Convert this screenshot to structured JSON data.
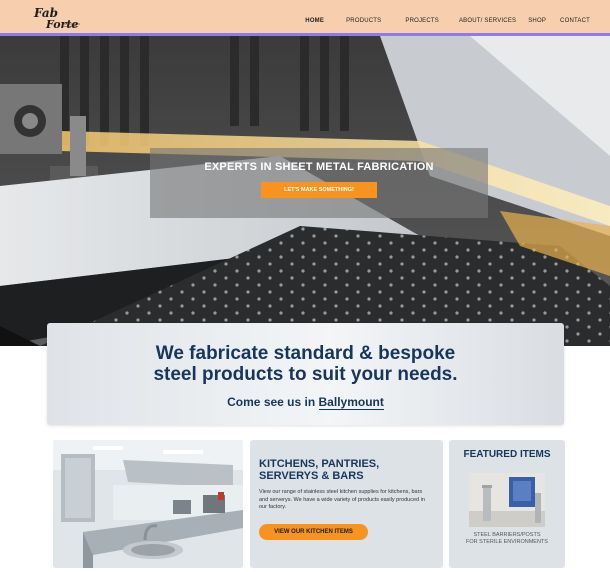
{
  "header": {
    "logo_text": "Fab Forte",
    "nav": [
      {
        "label": "HOME",
        "active": true
      },
      {
        "label": "PRODUCTS"
      },
      {
        "label": "PROJECTS"
      },
      {
        "label": "ABOUT/ SERVICES"
      },
      {
        "label": "SHOP"
      },
      {
        "label": "CONTACT"
      }
    ],
    "colors": {
      "background": "#f8cfae",
      "underline": "#8a7cf0"
    }
  },
  "hero": {
    "title": "EXPERTS IN SHEET METAL FABRICATION",
    "button_label": "LET'S MAKE SOMETHING!",
    "button_color": "#f7931e"
  },
  "intro": {
    "title_line1": "We fabricate standard & bespoke",
    "title_line2": "steel products to suit your needs.",
    "sub_prefix": "Come see us in ",
    "sub_highlight": "Ballymount",
    "text_color": "#17365d"
  },
  "kitchen_card": {
    "title_line1": "KITCHENS, PANTRIES,",
    "title_line2": "SERVERYS & BARS",
    "text": "View our range of stainless steel kitchen supplies for kitchens, bars and serverys. We have a wide variety of products easily produced in our factory.",
    "button_label": "VIEW OUR KITCHEN ITEMS"
  },
  "featured": {
    "title": "FEATURED ITEMS",
    "caption_line1": "STEEL BARRIERS/POSTS",
    "caption_line2": "FOR STERILE ENVIRONMENTS"
  }
}
